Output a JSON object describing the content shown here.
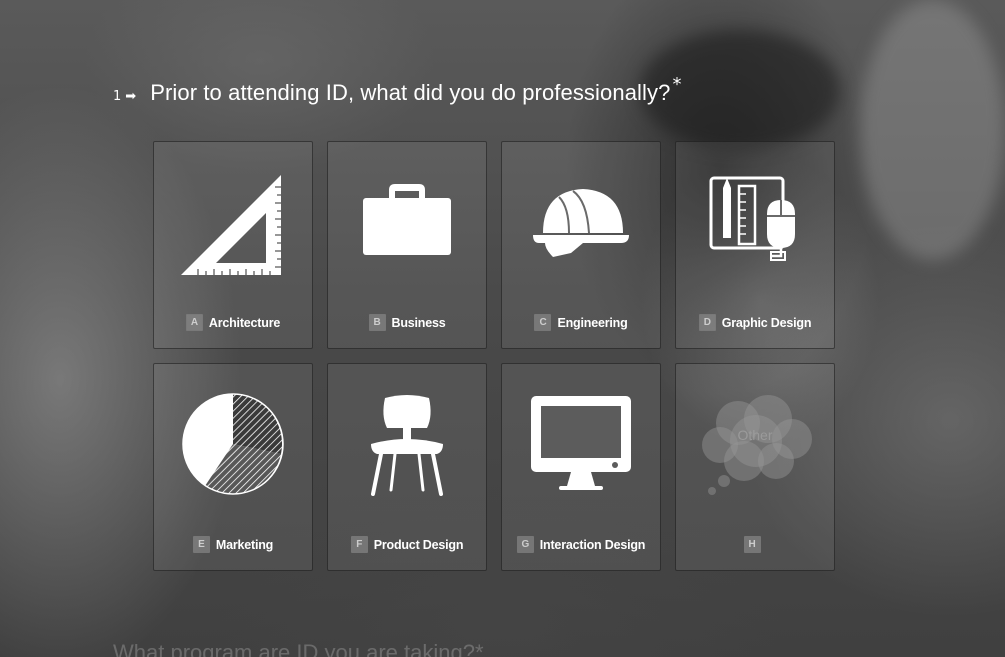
{
  "question": {
    "number": "1",
    "arrow": "➡",
    "text": "Prior to attending ID, what did you do professionally?",
    "required_mark": "*"
  },
  "choices": [
    {
      "key": "A",
      "label": "Architecture",
      "icon": "set-square-icon"
    },
    {
      "key": "B",
      "label": "Business",
      "icon": "briefcase-icon"
    },
    {
      "key": "C",
      "label": "Engineering",
      "icon": "hard-hat-icon"
    },
    {
      "key": "D",
      "label": "Graphic Design",
      "icon": "design-tools-icon"
    },
    {
      "key": "E",
      "label": "Marketing",
      "icon": "pie-chart-icon"
    },
    {
      "key": "F",
      "label": "Product Design",
      "icon": "chair-icon"
    },
    {
      "key": "G",
      "label": "Interaction Design",
      "icon": "monitor-icon"
    },
    {
      "key": "H",
      "label": "",
      "icon": "cloud-icon",
      "placeholder": "Other"
    }
  ],
  "next_question": {
    "text": "What program are ID you are taking?*"
  },
  "colors": {
    "text": "#ffffff",
    "key_bg": "#8a8a8a"
  }
}
